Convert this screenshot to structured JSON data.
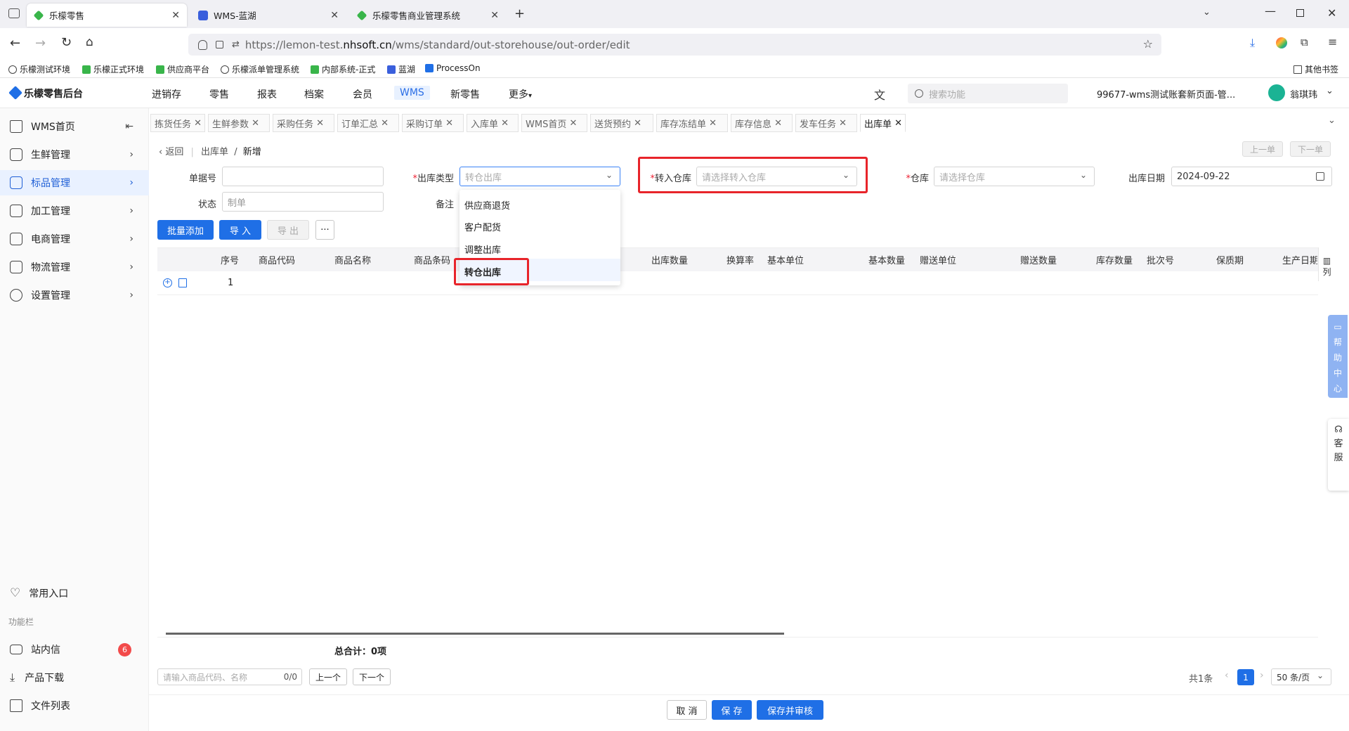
{
  "browser": {
    "tabs": [
      {
        "label": "乐檬零售",
        "active": true
      },
      {
        "label": "WMS-蓝湖",
        "active": false
      },
      {
        "label": "乐檬零售商业管理系统",
        "active": false
      }
    ],
    "url_prefix": "https://lemon-test.",
    "url_domain": "nhsoft.cn",
    "url_path": "/wms/standard/out-storehouse/out-order/edit",
    "bookmarks": [
      "乐檬测试环境",
      "乐檬正式环境",
      "供应商平台",
      "乐檬派单管理系统",
      "内部系统-正式",
      "蓝湖",
      "ProcessOn"
    ],
    "other_bookmarks": "其他书签"
  },
  "app": {
    "logo_text": "乐檬零售后台",
    "nav": [
      "进销存",
      "零售",
      "报表",
      "档案",
      "会员",
      "WMS",
      "新零售",
      "更多"
    ],
    "nav_selected": "WMS",
    "search_placeholder": "搜索功能",
    "account": "99677-wms测试账套新页面-管...",
    "user": "翁琪玮"
  },
  "sidebar": {
    "items": [
      "WMS首页",
      "生鲜管理",
      "标品管理",
      "加工管理",
      "电商管理",
      "物流管理",
      "设置管理"
    ],
    "selected": "标品管理",
    "common": "常用入口",
    "section": "功能栏",
    "bottom": [
      "站内信",
      "产品下载",
      "文件列表"
    ],
    "badge": "6"
  },
  "page_tabs": [
    "拣货任务",
    "生鲜参数",
    "采购任务",
    "订单汇总",
    "采购订单",
    "入库单",
    "WMS首页",
    "送货预约",
    "库存冻结单",
    "库存信息",
    "发车任务",
    "出库单"
  ],
  "breadcrumb": {
    "back": "返回",
    "parent": "出库单",
    "current": "新增",
    "prev": "上一单",
    "next": "下一单"
  },
  "form": {
    "doc_no_label": "单据号",
    "doc_no_value": "",
    "status_label": "状态",
    "status_value": "制单",
    "out_type_label": "出库类型",
    "out_type_value": "转仓出库",
    "remark_label": "备注",
    "transfer_label": "转入仓库",
    "transfer_placeholder": "请选择转入仓库",
    "warehouse_label": "仓库",
    "warehouse_placeholder": "请选择仓库",
    "date_label": "出库日期",
    "date_value": "2024-09-22"
  },
  "dropdown": [
    "供应商退货",
    "客户配货",
    "调整出库",
    "转仓出库"
  ],
  "dropdown_selected": "转仓出库",
  "actions": {
    "batch_add": "批量添加",
    "import": "导 入",
    "export": "导 出",
    "more": "···"
  },
  "table": {
    "headers": [
      "序号",
      "商品代码",
      "商品名称",
      "商品条码",
      "出库数量",
      "换算率",
      "基本单位",
      "基本数量",
      "赠送单位",
      "赠送数量",
      "库存数量",
      "批次号",
      "保质期",
      "生产日期"
    ],
    "row_no": "1",
    "col_setting": "列",
    "total": "总合计：0项"
  },
  "footer": {
    "search_placeholder": "请输入商品代码、名称",
    "count": "0/0",
    "prev": "上一个",
    "next": "下一个",
    "total": "共1条",
    "page": "1",
    "page_size": "50 条/页"
  },
  "buttons": {
    "cancel": "取 消",
    "save": "保 存",
    "save_audit": "保存并审核"
  },
  "float": {
    "help": "帮助中心",
    "service": "客服"
  }
}
